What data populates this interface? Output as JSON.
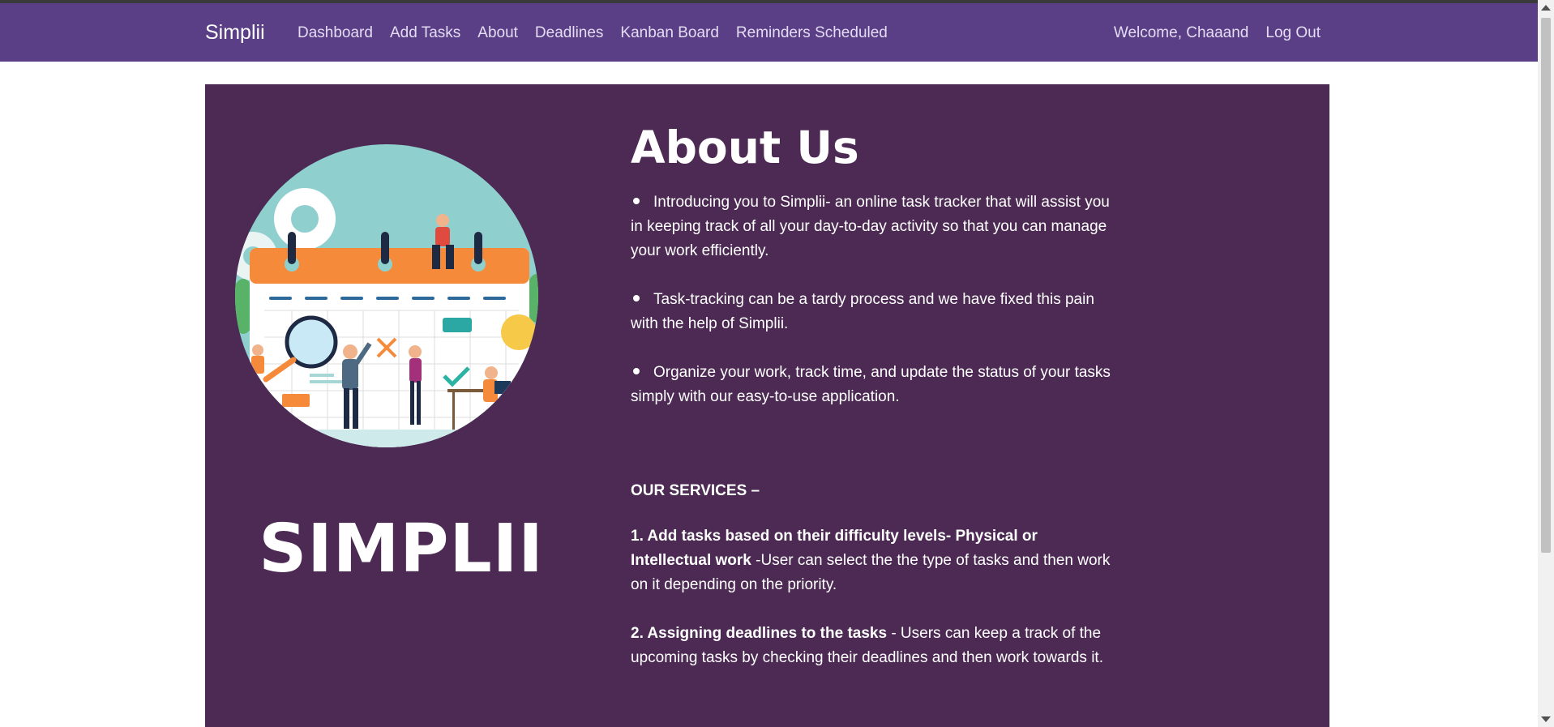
{
  "nav": {
    "brand": "Simplii",
    "links": [
      "Dashboard",
      "Add Tasks",
      "About",
      "Deadlines",
      "Kanban Board",
      "Reminders Scheduled"
    ],
    "welcome": "Welcome, Chaaand",
    "logout": "Log Out"
  },
  "colors": {
    "navbar": "#5a3f86",
    "hero": "#4c2a53",
    "illustration_bg": "#8fd0cf",
    "calendar_header": "#f58a3b"
  },
  "hero": {
    "big_brand": "SIMPLII",
    "illustration": "task-calendar-illustration"
  },
  "about": {
    "title": "About Us",
    "bullets": [
      "Introducing you to Simplii- an online task tracker that will assist you in keeping track of all your day-to-day activity so that you can manage your work efficiently.",
      "Task-tracking can be a tardy process and we have fixed this pain with the help of Simplii.",
      "Organize your work, track time, and update the status of your tasks simply with our easy-to-use application."
    ],
    "services_heading": "OUR SERVICES –",
    "services": [
      {
        "bold": "1. Add tasks based on their difficulty levels- Physical or Intellectual work",
        "text": " -User can select the the type of tasks and then work on it depending on the priority."
      },
      {
        "bold": "2. Assigning deadlines to the tasks",
        "text": " - Users can keep a track of the upcoming tasks by checking their deadlines and then work towards it."
      }
    ]
  }
}
